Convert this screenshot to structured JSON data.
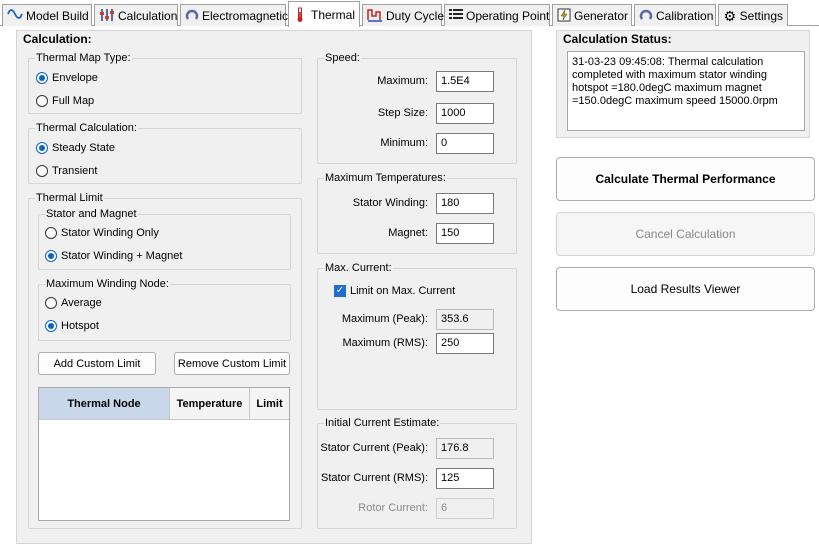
{
  "tabs": [
    {
      "label": "Model Build",
      "icon": "sine-wave-icon"
    },
    {
      "label": "Calculation",
      "icon": "sliders-icon"
    },
    {
      "label": "Electromagnetic",
      "icon": "magnet-icon"
    },
    {
      "label": "Thermal",
      "icon": "thermometer-icon",
      "active": true
    },
    {
      "label": "Duty Cycle",
      "icon": "duty-cycle-icon"
    },
    {
      "label": "Operating Point",
      "icon": "list-icon"
    },
    {
      "label": "Generator",
      "icon": "lightning-icon"
    },
    {
      "label": "Calibration",
      "icon": "calibration-icon"
    },
    {
      "label": "Settings",
      "icon": "gear-icon"
    }
  ],
  "calculation": {
    "title": "Calculation:",
    "thermal_map_type": {
      "title": "Thermal Map Type:",
      "options": [
        {
          "label": "Envelope",
          "selected": true
        },
        {
          "label": "Full Map",
          "selected": false
        }
      ]
    },
    "thermal_calculation": {
      "title": "Thermal Calculation:",
      "options": [
        {
          "label": "Steady State",
          "selected": true
        },
        {
          "label": "Transient",
          "selected": false
        }
      ]
    },
    "thermal_limit": {
      "title": "Thermal Limit",
      "stator_magnet": {
        "title": "Stator and Magnet",
        "options": [
          {
            "label": "Stator Winding Only",
            "selected": false
          },
          {
            "label": "Stator Winding + Magnet",
            "selected": true
          }
        ]
      },
      "winding_node": {
        "title": "Maximum Winding Node:",
        "options": [
          {
            "label": "Average",
            "selected": false
          },
          {
            "label": "Hotspot",
            "selected": true
          }
        ]
      },
      "add_custom_limit": "Add Custom Limit",
      "remove_custom_limit": "Remove Custom Limit",
      "table_headers": [
        "Thermal Node",
        "Temperature",
        "Limit"
      ]
    },
    "speed": {
      "title": "Speed:",
      "maximum_label": "Maximum:",
      "maximum": "1.5E4",
      "step_label": "Step Size:",
      "step": "1000",
      "minimum_label": "Minimum:",
      "minimum": "0"
    },
    "max_temps": {
      "title": "Maximum Temperatures:",
      "stator_label": "Stator Winding:",
      "stator": "180",
      "magnet_label": "Magnet:",
      "magnet": "150"
    },
    "max_current": {
      "title": "Max. Current:",
      "limit_label": "Limit on Max. Current",
      "peak_label": "Maximum (Peak):",
      "peak": "353.6",
      "rms_label": "Maximum (RMS):",
      "rms": "250"
    },
    "initial_current": {
      "title": "Initial Current Estimate:",
      "peak_label": "Stator Current (Peak):",
      "peak": "176.8",
      "rms_label": "Stator Current (RMS):",
      "rms": "125",
      "rotor_label": "Rotor Current:",
      "rotor": "6"
    }
  },
  "status": {
    "title": "Calculation Status:",
    "text": "31-03-23 09:45:08: Thermal calculation completed with maximum stator winding hotspot =180.0degC maximum magnet =150.0degC maximum speed 15000.0rpm"
  },
  "actions": {
    "calculate": "Calculate Thermal Performance",
    "cancel": "Cancel Calculation",
    "load_results": "Load Results Viewer"
  }
}
